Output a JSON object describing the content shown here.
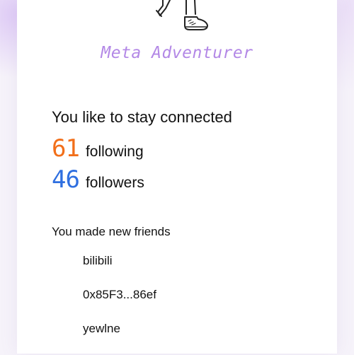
{
  "profile": {
    "title": "Meta Adventurer",
    "title_color": "#b388e6",
    "illustration": "walking-character-legs-sneakers-illustration"
  },
  "connections": {
    "heading": "You like to stay connected",
    "following": {
      "count": "61",
      "label": "following",
      "color": "#f26f1a"
    },
    "followers": {
      "count": "46",
      "label": "followers",
      "color": "#2f6fe0"
    }
  },
  "friends": {
    "heading": "You made new friends",
    "items": [
      {
        "name": "bilibili"
      },
      {
        "name": "0x85F3...86ef"
      },
      {
        "name": "yewlne"
      }
    ]
  }
}
